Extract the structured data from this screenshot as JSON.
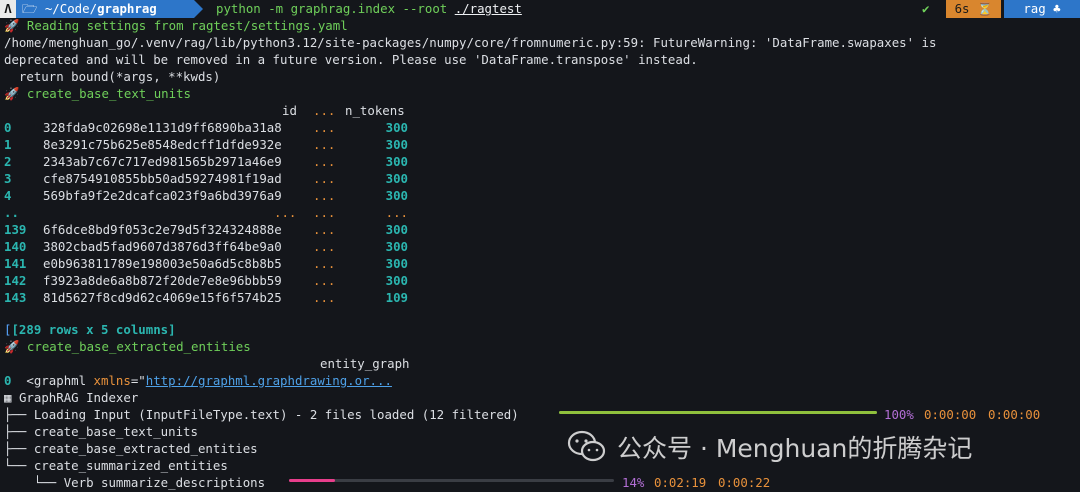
{
  "prompt": {
    "logo_glyph": "Λ",
    "folder_glyph": "🗁",
    "path_prefix": "~/Code/",
    "path_repo": "graphrag",
    "command_main": "python -m graphrag.index --root ",
    "command_arg": "./ragtest",
    "status_check": "✔",
    "duration": "6s ⏳",
    "env": "rag ♣"
  },
  "lines": {
    "reading": "Reading settings from ragtest/settings.yaml",
    "warn1": "/home/menghuan_go/.venv/rag/lib/python3.12/site-packages/numpy/core/fromnumeric.py:59: FutureWarning: 'DataFrame.swapaxes' is",
    "warn2": "deprecated and will be removed in a future version. Please use 'DataFrame.transpose' instead.",
    "warn3": "  return bound(*args, **kwds)",
    "step1": "create_base_text_units",
    "rows_summary": "[289 rows x 5 columns]",
    "step2": "create_base_extracted_entities",
    "col_entity": "entity_graph"
  },
  "table": {
    "header_id": "id",
    "header_ellipsis": "...",
    "header_tokens": "n_tokens",
    "rows": [
      {
        "idx": "0",
        "id": "328fda9c02698e1131d9ff6890ba31a8",
        "mid": "...",
        "tok": "300"
      },
      {
        "idx": "1",
        "id": "8e3291c75b625e8548edcff1dfde932e",
        "mid": "...",
        "tok": "300"
      },
      {
        "idx": "2",
        "id": "2343ab7c67c717ed981565b2971a46e9",
        "mid": "...",
        "tok": "300"
      },
      {
        "idx": "3",
        "id": "cfe8754910855bb50ad59274981f19ad",
        "mid": "...",
        "tok": "300"
      },
      {
        "idx": "4",
        "id": "569bfa9f2e2dcafca023f9a6bd3976a9",
        "mid": "...",
        "tok": "300"
      },
      {
        "idx": "..",
        "id": "...",
        "mid": "...",
        "tok": "..."
      },
      {
        "idx": "139",
        "id": "6f6dce8bd9f053c2e79d5f324324888e",
        "mid": "...",
        "tok": "300"
      },
      {
        "idx": "140",
        "id": "3802cbad5fad9607d3876d3ff64be9a0",
        "mid": "...",
        "tok": "300"
      },
      {
        "idx": "141",
        "id": "e0b963811789e198003e50a6d5c8b8b5",
        "mid": "...",
        "tok": "300"
      },
      {
        "idx": "142",
        "id": "f3923a8de6a8b872f20de7e8e96bbb59",
        "mid": "...",
        "tok": "300"
      },
      {
        "idx": "143",
        "id": "81d5627f8cd9d62c4069e15f6f574b25",
        "mid": "...",
        "tok": "109"
      }
    ]
  },
  "graphml": {
    "idx": "0",
    "tag": "<graphml ",
    "attr": "xmlns",
    "eq": "=\"",
    "url": "http://graphml.graphdrawing.or..."
  },
  "indexer": {
    "title": "GraphRAG Indexer",
    "tree1": "├── ",
    "tree2": "├── ",
    "tree3": "├── ",
    "tree4": "└── ",
    "tree5": "    └── ",
    "loading": "Loading Input (InputFileType.text) - 2 files loaded (12 filtered)",
    "loading_pct": "100%",
    "loading_elapsed": "0:00:00",
    "loading_remaining": "0:00:00",
    "loading_progress": 1.0,
    "task1": "create_base_text_units",
    "task2": "create_base_extracted_entities",
    "task3": "create_summarized_entities",
    "verb": "Verb summarize_descriptions",
    "verb_pct": "14%",
    "verb_elapsed": "0:02:19",
    "verb_remaining": "0:00:22",
    "verb_progress": 0.14
  },
  "watermark": {
    "text": "公众号 · Menghuan的折腾杂记"
  },
  "colors": {
    "green": "#6fcf5a",
    "orange": "#e8913b",
    "cyan": "#2bb6b0",
    "pink": "#e83e8c",
    "progress_done": "#8fc03c",
    "progress_track": "#3a3d44"
  }
}
